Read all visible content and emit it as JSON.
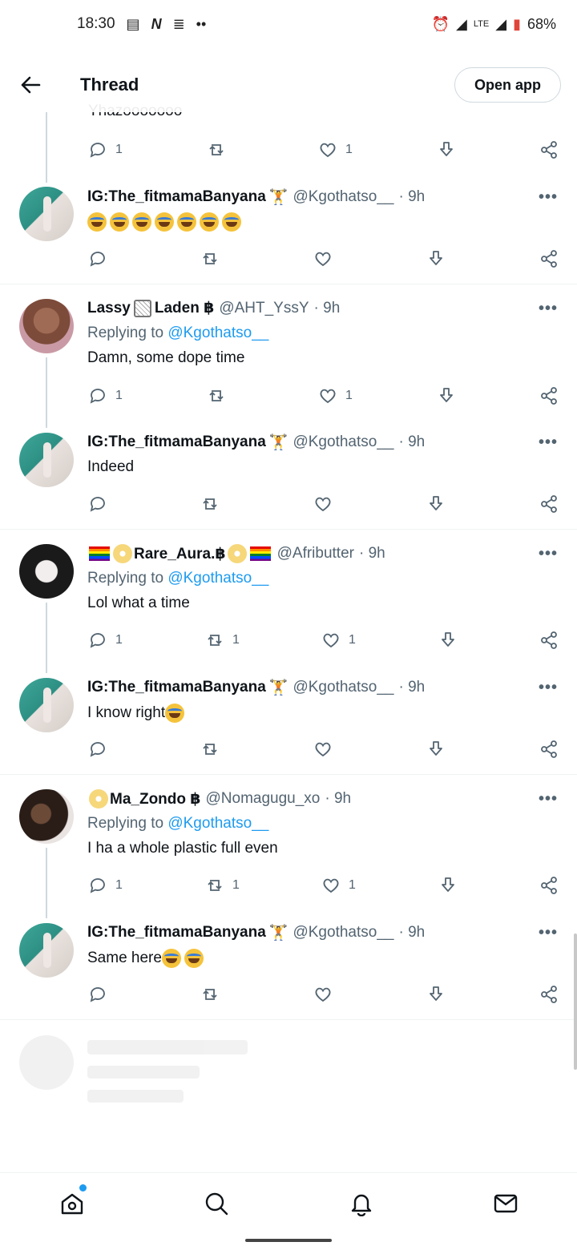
{
  "status_bar": {
    "time": "18:30",
    "battery": "68%",
    "network": "LTE"
  },
  "header": {
    "title": "Thread",
    "open_app_label": "Open app"
  },
  "cut_text": "Yhazooooooo",
  "top_actions": {
    "reply_count": "1",
    "like_count": "1"
  },
  "tweets": [
    {
      "name": "IG:The_fitmamaBanyana",
      "handle": "@Kgothatso__",
      "time": "· 9h",
      "body": "",
      "emoji_count": 7,
      "reply_count": "",
      "retweet_count": "",
      "like_count": ""
    },
    {
      "name": "Lassy",
      "name_suffix": "Laden ฿",
      "handle": "@AHT_YssY",
      "time": "· 9h",
      "replying_prefix": "Replying to ",
      "replying_to": "@Kgothatso__",
      "body": "Damn, some dope time",
      "reply_count": "1",
      "retweet_count": "",
      "like_count": "1"
    },
    {
      "name": "IG:The_fitmamaBanyana",
      "handle": "@Kgothatso__",
      "time": "· 9h",
      "body": "Indeed",
      "reply_count": "",
      "retweet_count": "",
      "like_count": ""
    },
    {
      "name": "Rare_Aura.฿",
      "handle": "@Afributter",
      "time": "· 9h",
      "replying_prefix": "Replying to ",
      "replying_to": "@Kgothatso__",
      "body": "Lol what a time",
      "reply_count": "1",
      "retweet_count": "1",
      "like_count": "1"
    },
    {
      "name": "IG:The_fitmamaBanyana",
      "handle": "@Kgothatso__",
      "time": "· 9h",
      "body": "I know right",
      "reply_count": "",
      "retweet_count": "",
      "like_count": ""
    },
    {
      "name": "Ma_Zondo ฿",
      "handle": "@Nomagugu_xo",
      "time": "· 9h",
      "replying_prefix": "Replying to ",
      "replying_to": "@Kgothatso__",
      "body": "I ha a whole plastic full even",
      "reply_count": "1",
      "retweet_count": "1",
      "like_count": "1"
    },
    {
      "name": "IG:The_fitmamaBanyana",
      "handle": "@Kgothatso__",
      "time": "· 9h",
      "body": "Same here",
      "reply_count": "",
      "retweet_count": "",
      "like_count": ""
    }
  ],
  "more_label": "•••",
  "colors": {
    "accent": "#1d9bf0",
    "text": "#0f1419",
    "muted": "#536471",
    "divider": "#eff3f4"
  }
}
